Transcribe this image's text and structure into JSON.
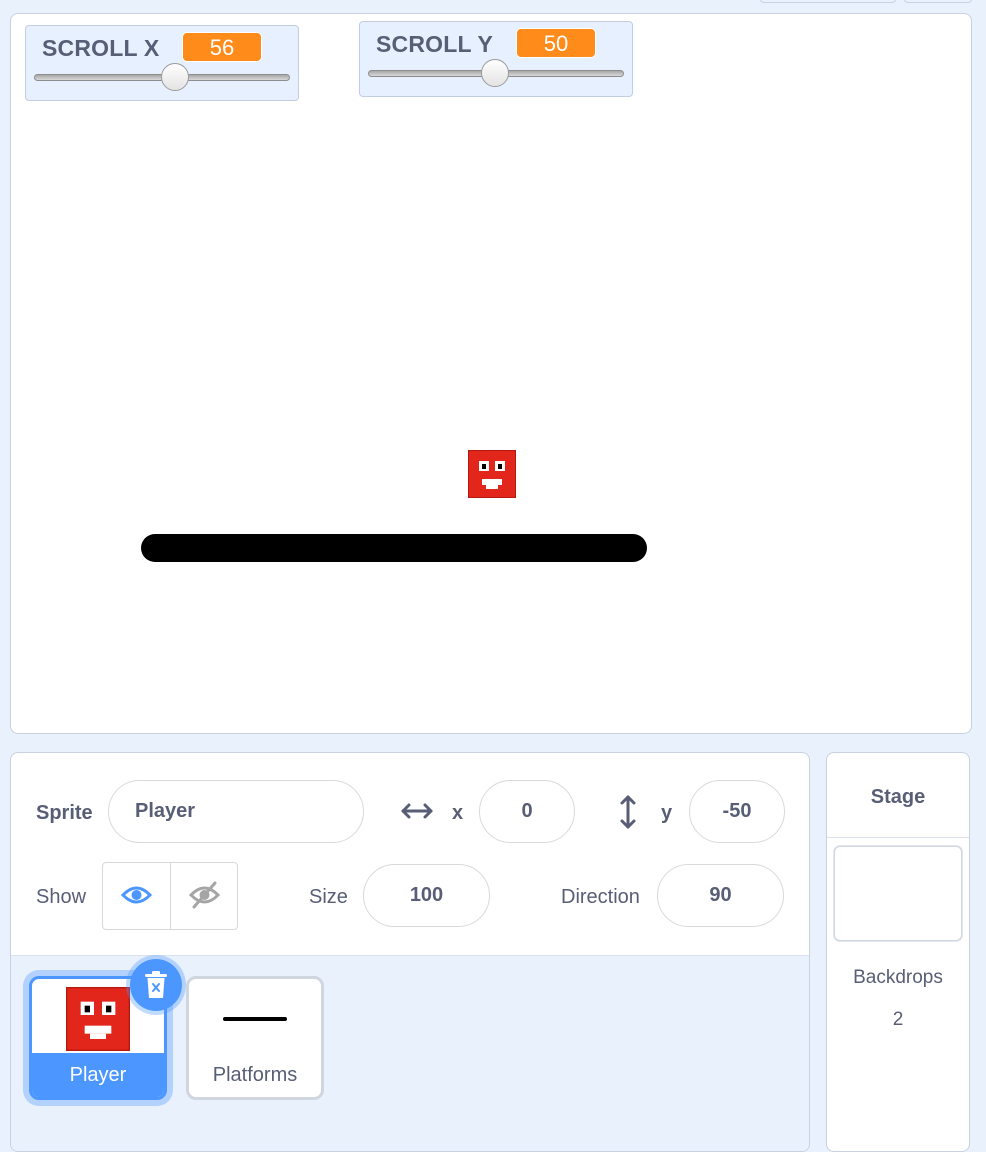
{
  "monitors": [
    {
      "label": "SCROLL X",
      "value": "56",
      "slider_fraction": 0.56
    },
    {
      "label": "SCROLL Y",
      "value": "50",
      "slider_fraction": 0.5
    }
  ],
  "sprite_info": {
    "sprite_label": "Sprite",
    "sprite_name": "Player",
    "x_label": "x",
    "x_value": "0",
    "y_label": "y",
    "y_value": "-50",
    "show_label": "Show",
    "size_label": "Size",
    "size_value": "100",
    "direction_label": "Direction",
    "direction_value": "90"
  },
  "sprites": [
    {
      "name": "Player",
      "selected": true
    },
    {
      "name": "Platforms",
      "selected": false
    }
  ],
  "stage_panel": {
    "title": "Stage",
    "backdrops_label": "Backdrops",
    "backdrops_count": "2"
  },
  "colors": {
    "accent": "#4c97ff",
    "monitor_value": "#ff8c1a",
    "sprite_red": "#e3261b",
    "platform": "#000000"
  },
  "icons": [
    "eye-icon",
    "eye-slash-icon",
    "horizontal-arrows-icon",
    "vertical-arrows-icon",
    "trash-icon"
  ]
}
